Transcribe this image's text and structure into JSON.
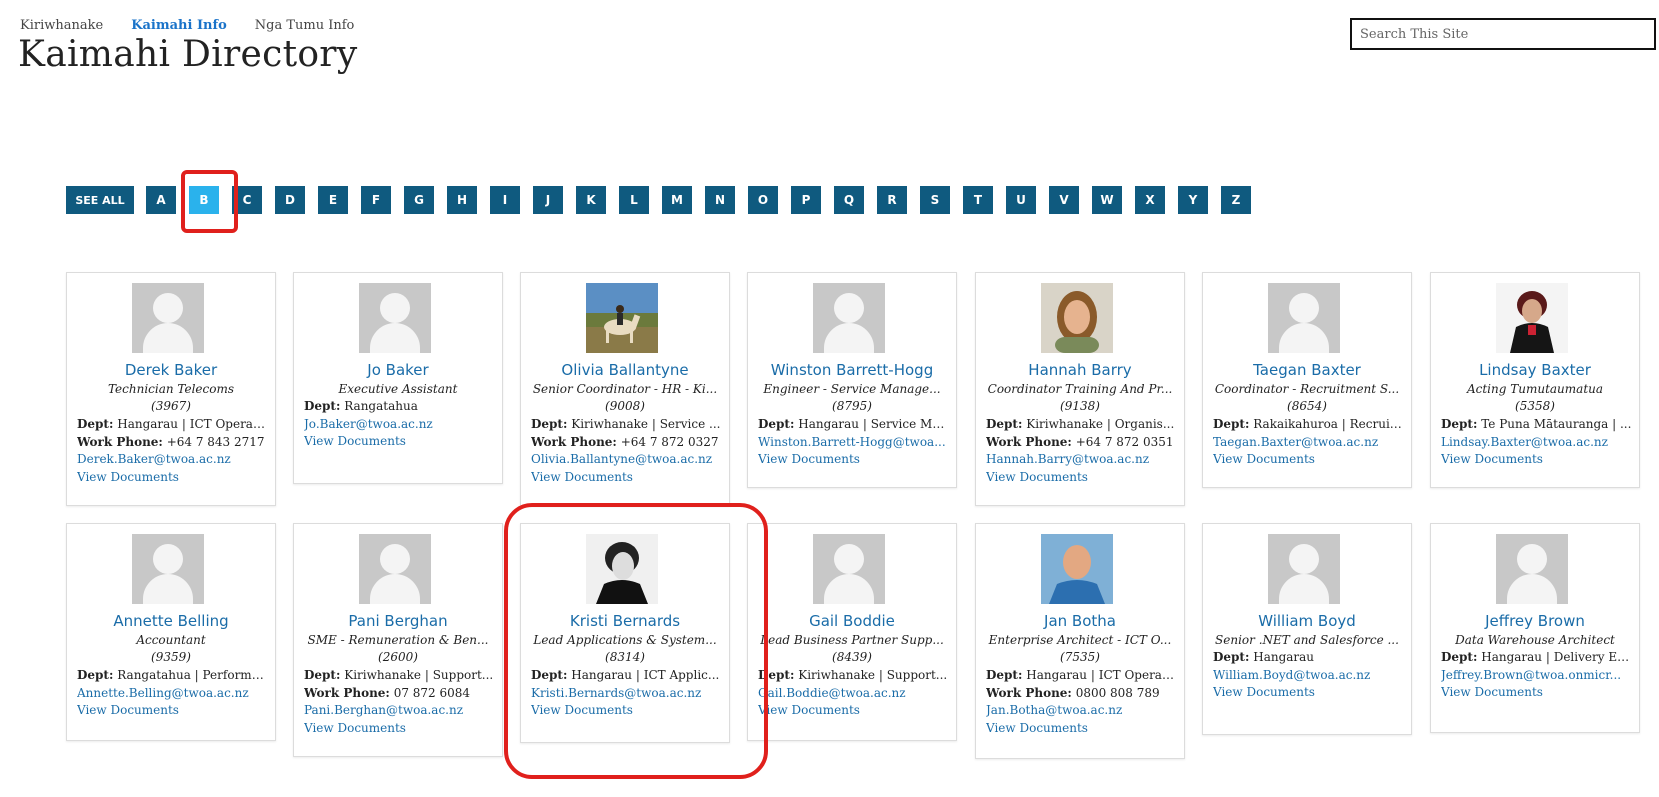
{
  "topnav": {
    "items": [
      "Kiriwhanake",
      "Kaimahi Info",
      "Nga Tumu Info"
    ]
  },
  "page_title": "Kaimahi Directory",
  "search": {
    "placeholder": "Search This Site"
  },
  "alphabet": {
    "see_all": "SEE ALL",
    "letters": [
      "A",
      "B",
      "C",
      "D",
      "E",
      "F",
      "G",
      "H",
      "I",
      "J",
      "K",
      "L",
      "M",
      "N",
      "O",
      "P",
      "Q",
      "R",
      "S",
      "T",
      "U",
      "V",
      "W",
      "X",
      "Y",
      "Z"
    ],
    "active": "B"
  },
  "labels": {
    "dept": "Dept:",
    "work_phone": "Work Phone:",
    "view_documents": "View Documents"
  },
  "cards": [
    {
      "name": "Derek Baker",
      "title": "Technician Telecoms",
      "ext": "(3967)",
      "dept": "Hangarau | ICT Operati...",
      "phone": "+64 7 843 2717",
      "email": "Derek.Baker@twoa.ac.nz"
    },
    {
      "name": "Jo Baker",
      "title": "Executive Assistant",
      "ext": "",
      "dept": "Rangatahua",
      "phone": "",
      "email": "Jo.Baker@twoa.ac.nz"
    },
    {
      "name": "Olivia Ballantyne",
      "title": "Senior Coordinator - HR - Ki...",
      "ext": "(9008)",
      "dept": "Kiriwhanake | Service ...",
      "phone": "+64 7 872 0327",
      "email": "Olivia.Ballantyne@twoa.ac.nz"
    },
    {
      "name": "Winston Barrett-Hogg",
      "title": "Engineer - Service Manage...",
      "ext": "(8795)",
      "dept": "Hangarau | Service Ma...",
      "phone": "",
      "email": "Winston.Barrett-Hogg@twoa..."
    },
    {
      "name": "Hannah Barry",
      "title": "Coordinator Training And Pr...",
      "ext": "(9138)",
      "dept": "Kiriwhanake | Organis...",
      "phone": "+64 7 872 0351",
      "email": "Hannah.Barry@twoa.ac.nz"
    },
    {
      "name": "Taegan Baxter",
      "title": "Coordinator - Recruitment S...",
      "ext": "(8654)",
      "dept": "Rakaikahuroa | Recruit...",
      "phone": "",
      "email": "Taegan.Baxter@twoa.ac.nz"
    },
    {
      "name": "Lindsay Baxter",
      "title": "Acting Tumutaumatua",
      "ext": "(5358)",
      "dept": "Te Puna Mātauranga | ...",
      "phone": "",
      "email": "Lindsay.Baxter@twoa.ac.nz"
    },
    {
      "name": "Annette Belling",
      "title": "Accountant",
      "ext": "(9359)",
      "dept": "Rangatahua | Performa...",
      "phone": "",
      "email": "Annette.Belling@twoa.ac.nz"
    },
    {
      "name": "Pani Berghan",
      "title": "SME - Remuneration & Ben...",
      "ext": "(2600)",
      "dept": "Kiriwhanake | Support...",
      "phone": "07 872 6084",
      "email": "Pani.Berghan@twoa.ac.nz"
    },
    {
      "name": "Kristi Bernards",
      "title": "Lead Applications & System...",
      "ext": "(8314)",
      "dept": "Hangarau | ICT Applic...",
      "phone": "",
      "email": "Kristi.Bernards@twoa.ac.nz"
    },
    {
      "name": "Gail Boddie",
      "title": "Lead Business Partner Supp...",
      "ext": "(8439)",
      "dept": "Kiriwhanake | Support...",
      "phone": "",
      "email": "Gail.Boddie@twoa.ac.nz"
    },
    {
      "name": "Jan Botha",
      "title": "Enterprise Architect - ICT O...",
      "ext": "(7535)",
      "dept": "Hangarau | ICT Operati...",
      "phone": "0800 808 789",
      "email": "Jan.Botha@twoa.ac.nz"
    },
    {
      "name": "William Boyd",
      "title": "Senior .NET and Salesforce ...",
      "ext": "",
      "dept": "Hangarau",
      "phone": "",
      "email": "William.Boyd@twoa.ac.nz"
    },
    {
      "name": "Jeffrey Brown",
      "title": "Data Warehouse Architect",
      "ext": "",
      "dept": "Hangarau | Delivery En...",
      "phone": "",
      "email": "Jeffrey.Brown@twoa.onmicr..."
    }
  ]
}
